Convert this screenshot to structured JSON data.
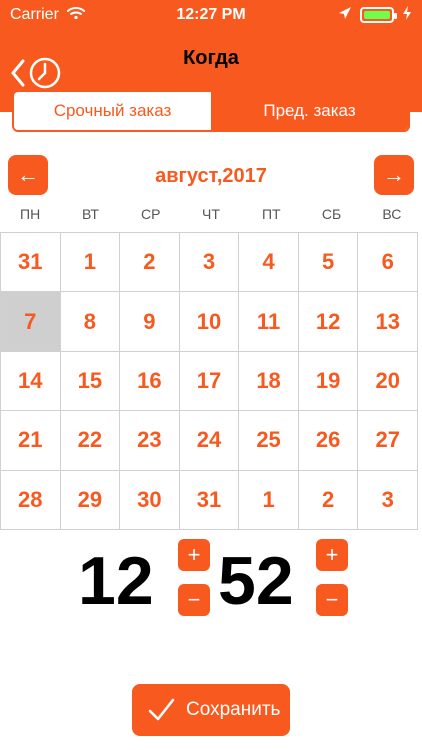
{
  "status": {
    "carrier": "Carrier",
    "time": "12:27 PM",
    "icons": [
      "wifi-icon",
      "location-icon",
      "battery-icon",
      "charging-icon"
    ]
  },
  "header": {
    "title": "Когда",
    "back_icon": "back-clock-icon"
  },
  "tabs": {
    "left": "Срочный заказ",
    "right": "Пред. заказ",
    "active": "right"
  },
  "calendar": {
    "month_label": "август,2017",
    "weekdays": [
      "ПН",
      "ВТ",
      "СР",
      "ЧТ",
      "ПТ",
      "СБ",
      "ВС"
    ],
    "days": [
      "31",
      "1",
      "2",
      "3",
      "4",
      "5",
      "6",
      "7",
      "8",
      "9",
      "10",
      "11",
      "12",
      "13",
      "14",
      "15",
      "16",
      "17",
      "18",
      "19",
      "20",
      "21",
      "22",
      "23",
      "24",
      "25",
      "26",
      "27",
      "28",
      "29",
      "30",
      "31",
      "1",
      "2",
      "3"
    ],
    "selected_index": 7
  },
  "time": {
    "hour": "12",
    "minute": "52",
    "plus": "+",
    "minus": "−"
  },
  "save": {
    "label": "Сохранить",
    "icon": "check-icon"
  },
  "colors": {
    "accent": "#f7591f",
    "selected_bg": "#cfcfcf"
  }
}
